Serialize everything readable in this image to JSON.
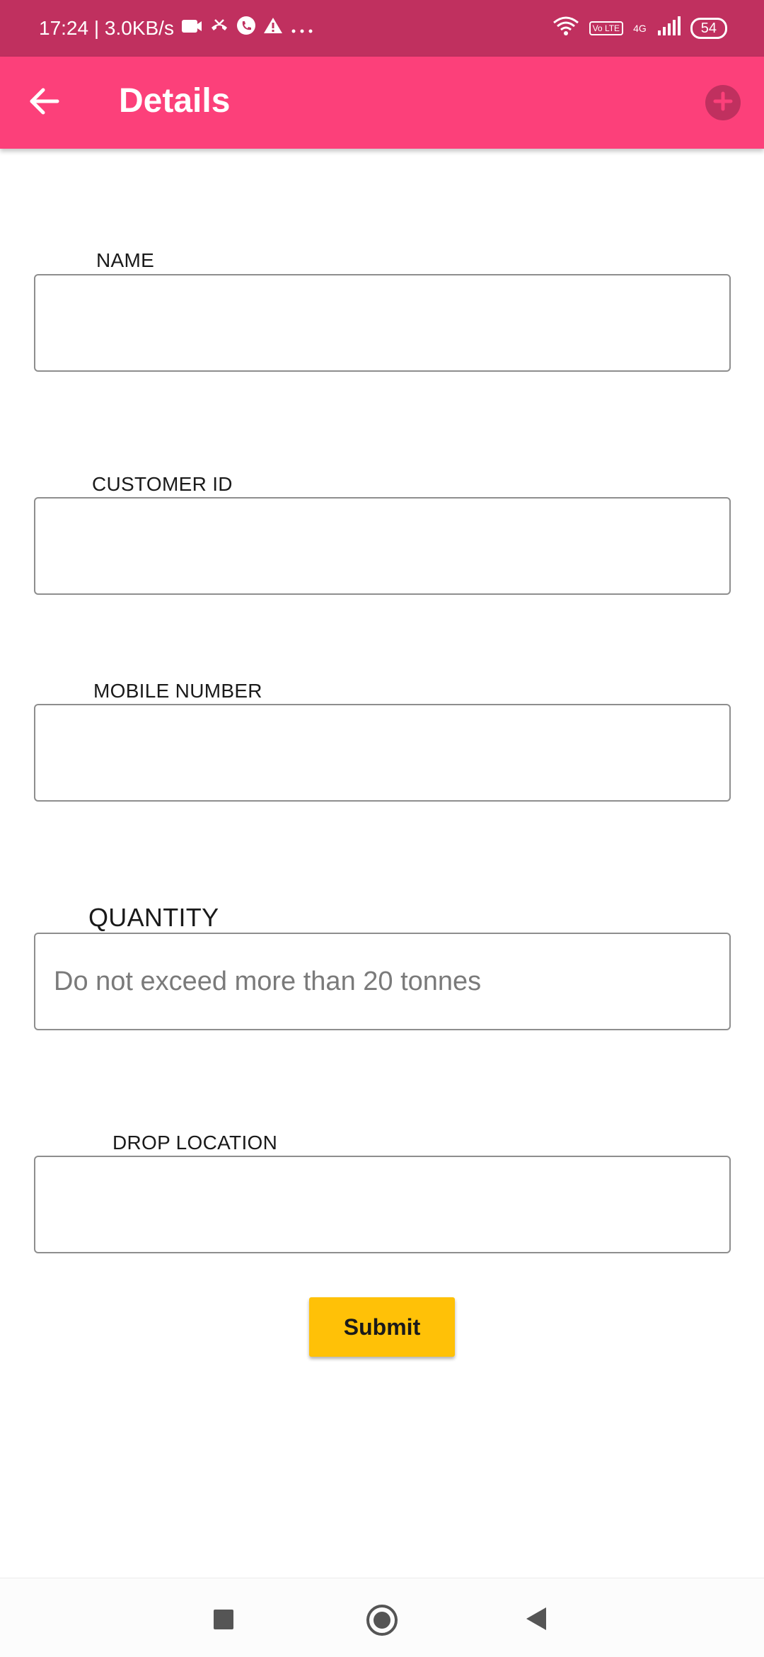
{
  "status_bar": {
    "time_speed": "17:24 | 3.0KB/s",
    "battery": "54",
    "volte": "Vo LTE",
    "network": "4G"
  },
  "app_bar": {
    "title": "Details"
  },
  "form": {
    "name_label": "NAME",
    "name_value": "",
    "customer_id_label": "CUSTOMER ID",
    "customer_id_value": "",
    "mobile_label": "MOBILE NUMBER",
    "mobile_value": "",
    "quantity_label": "QUANTITY",
    "quantity_placeholder": "Do not exceed more than 20 tonnes",
    "quantity_value": "",
    "drop_location_label": "DROP LOCATION",
    "drop_location_value": ""
  },
  "submit_label": "Submit",
  "icons": {
    "back": "arrow-back-icon",
    "add": "add-circle-icon",
    "recents": "nav-recents-icon",
    "home": "nav-home-icon",
    "nav_back": "nav-back-icon"
  },
  "colors": {
    "status_bar": "#c0305f",
    "app_bar": "#fc407a",
    "submit": "#ffc107"
  }
}
